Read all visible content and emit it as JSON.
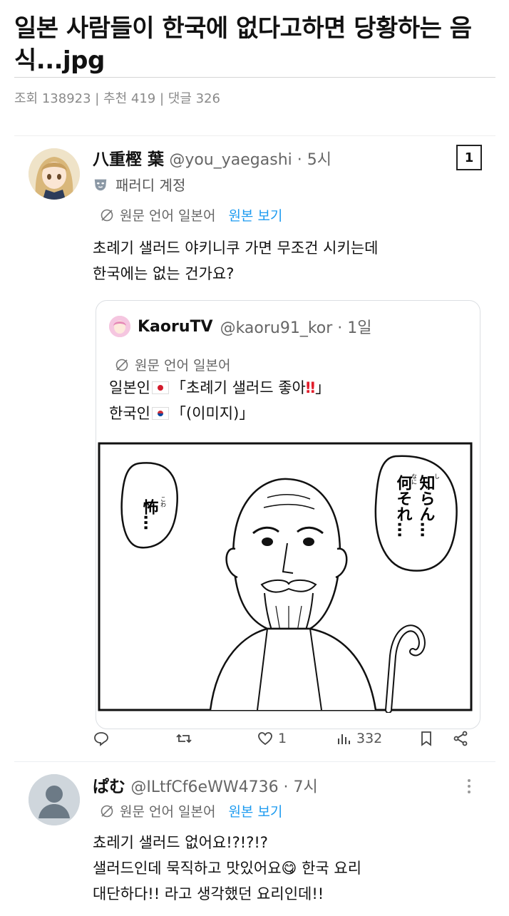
{
  "post": {
    "title": "일본 사람들이 한국에 없다고하면 당황하는 음식...jpg",
    "meta": "조회 138923 | 추천 419 | 댓글 326"
  },
  "tweet1": {
    "name": "八重樫 葉",
    "handle": "@you_yaegashi · 5시",
    "parody_label": "패러디 계정",
    "badge": "1",
    "lang_label": "원문 언어 일본어",
    "view_original": "원본 보기",
    "text_lines": [
      "초례기 샐러드 야키니쿠 가면 무조건 시키는데",
      "한국에는 없는 건가요?"
    ]
  },
  "quote": {
    "name": "KaoruTV",
    "handle": "@kaoru91_kor · 1일",
    "lang_label": "원문 언어 일본어",
    "line1_prefix": "일본인",
    "line1_text": "「초례기 샐러드 좋아",
    "line1_bang": "‼",
    "line1_close": "」",
    "line2_prefix": "한국인",
    "line2_text": "「(이미지)」",
    "manga_bubble_left": "怖…",
    "manga_bubble_left_ruby": "こわ",
    "manga_bubble_right_col1": "知らん…",
    "manga_bubble_right_col2": "何それ…",
    "manga_ruby1": "し",
    "manga_ruby2": "なに"
  },
  "actions": {
    "likes": "1",
    "views": "332",
    "icons": [
      "reply-icon",
      "retweet-icon",
      "heart-icon",
      "views-icon",
      "bookmark-icon",
      "share-icon"
    ]
  },
  "tweet2": {
    "name": "ぱむ",
    "handle": "@ILtfCf6eWW4736 · 7시",
    "lang_label": "원문 언어 일본어",
    "view_original": "원본 보기",
    "text_lines": [
      "쵸레기 샐러드 없어요!?!?!?",
      "샐러드인데 묵직하고 맛있어요😋 한국 요리",
      "대단하다!! 라고 생각했던 요리인데!!"
    ]
  },
  "colors": {
    "link": "#1d9bf0",
    "muted": "#666666",
    "accent_red": "#e11d2b"
  }
}
